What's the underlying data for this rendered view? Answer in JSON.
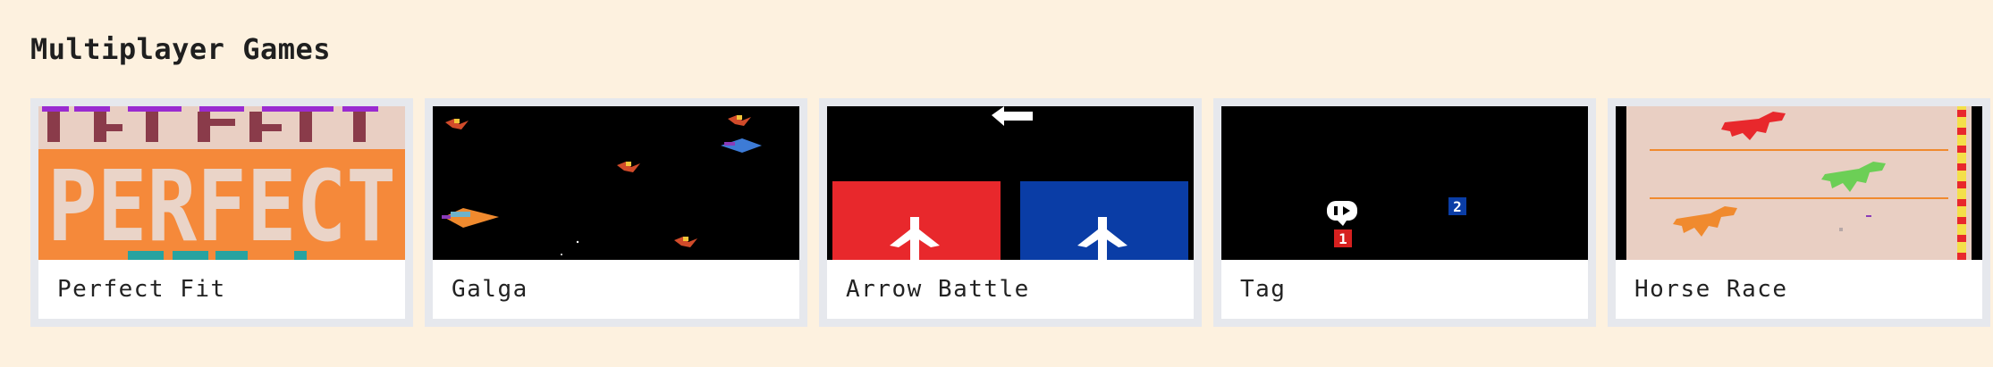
{
  "page": {
    "section_title": "Multiplayer Games"
  },
  "games": [
    {
      "title": "Perfect Fit",
      "thumbnail": "perfect-fit-thumbnail",
      "thumb_text": "PERFECT"
    },
    {
      "title": "Galga",
      "thumbnail": "galga-thumbnail"
    },
    {
      "title": "Arrow Battle",
      "thumbnail": "arrow-battle-thumbnail"
    },
    {
      "title": "Tag",
      "thumbnail": "tag-thumbnail",
      "player_labels": [
        "1",
        "2"
      ]
    },
    {
      "title": "Horse Race",
      "thumbnail": "horse-race-thumbnail"
    }
  ],
  "colors": {
    "background": "#fdf1df",
    "card_border": "#e6e8ed",
    "text": "#1f1f1f"
  }
}
